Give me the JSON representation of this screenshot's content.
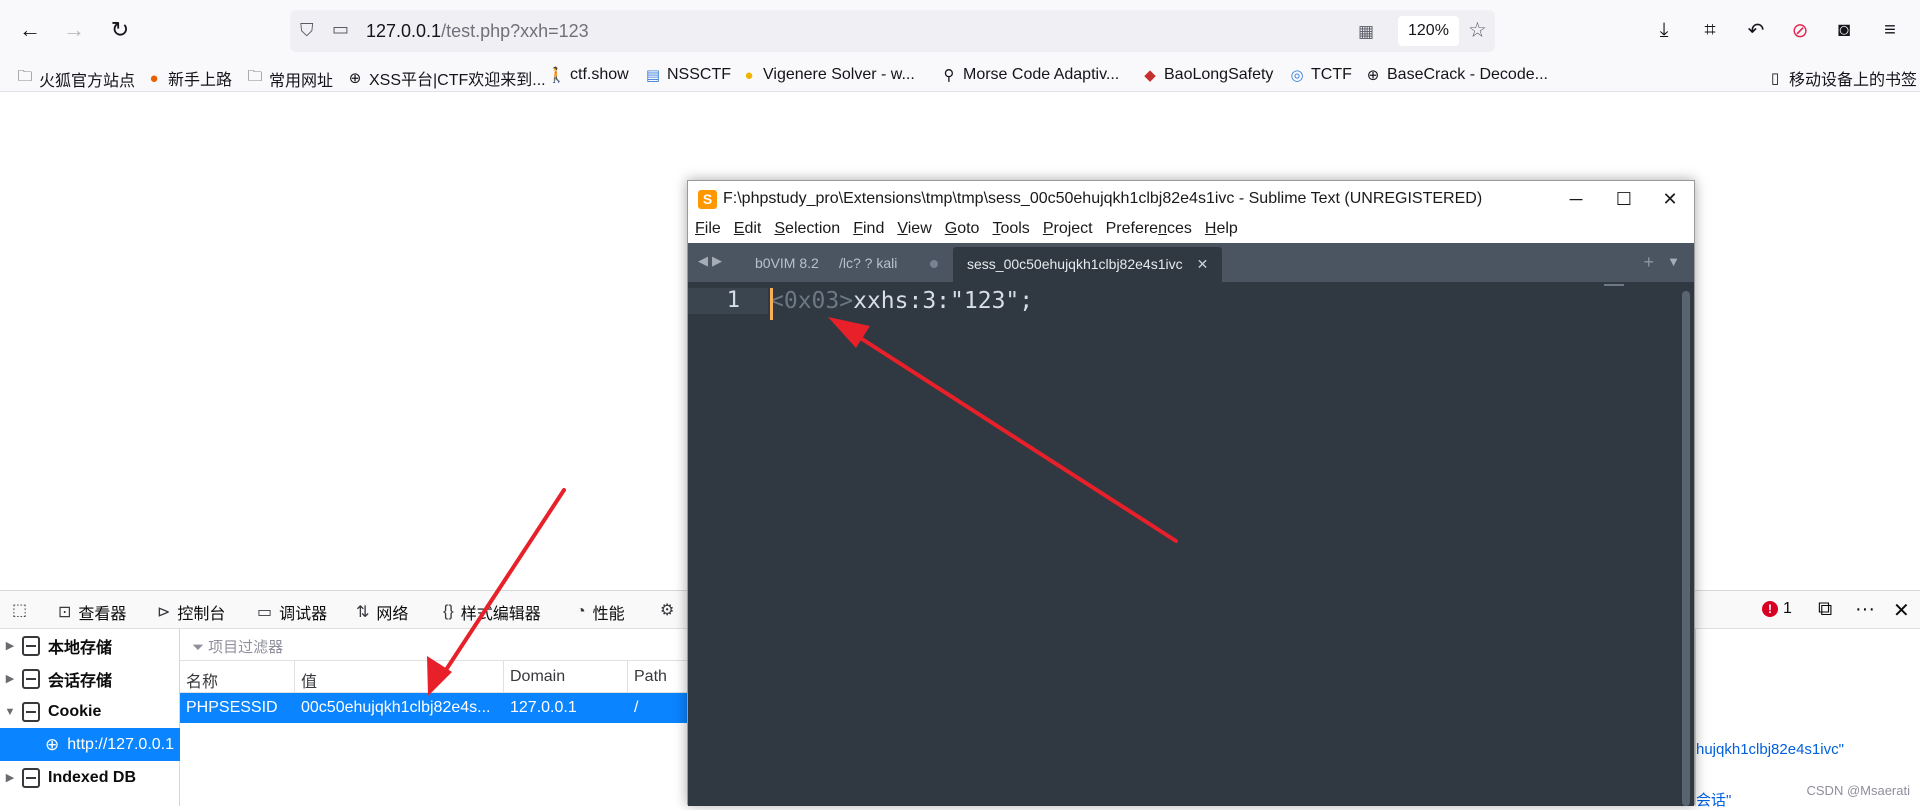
{
  "browser": {
    "url_host": "127.0.0.1",
    "url_rest": "/test.php?xxh=123",
    "zoom": "120%",
    "bookmarks": [
      {
        "label": "火狐官方站点",
        "icon": "folder-icon"
      },
      {
        "label": "新手上路",
        "icon": "firefox-icon"
      },
      {
        "label": "常用网址",
        "icon": "folder-icon"
      },
      {
        "label": "XSS平台|CTF欢迎来到...",
        "icon": "globe-icon"
      },
      {
        "label": "ctf.show",
        "icon": "ctfshow-icon"
      },
      {
        "label": "NSSCTF",
        "icon": "nssctf-icon"
      },
      {
        "label": "Vigenere Solver - w...",
        "icon": "vigenere-icon"
      },
      {
        "label": "Morse Code Adaptiv...",
        "icon": "morse-icon"
      },
      {
        "label": "BaoLongSafety",
        "icon": "baolong-icon"
      },
      {
        "label": "TCTF",
        "icon": "tctf-icon"
      },
      {
        "label": "BaseCrack - Decode...",
        "icon": "globe-icon"
      }
    ],
    "mobile_bookmarks": "移动设备上的书签"
  },
  "sublime": {
    "title": "F:\\phpstudy_pro\\Extensions\\tmp\\tmp\\sess_00c50ehujqkh1clbj82e4s1ivc - Sublime Text (UNREGISTERED)",
    "menu": [
      {
        "first": "F",
        "rest": "ile"
      },
      {
        "first": "E",
        "rest": "dit"
      },
      {
        "first": "S",
        "rest": "election"
      },
      {
        "first": "F",
        "rest": "ind"
      },
      {
        "first": "V",
        "rest": "iew"
      },
      {
        "first": "G",
        "rest": "oto"
      },
      {
        "first": "T",
        "rest": "ools"
      },
      {
        "first": "P",
        "rest": "roject"
      },
      {
        "first": "Prefere",
        "rest": "n",
        "tail": "ces"
      },
      {
        "first": "H",
        "rest": "elp"
      }
    ],
    "tabs": [
      "b0VIM 8.2",
      "/lc? ?  kali",
      "sess_00c50ehujqkh1clbj82e4s1ivc"
    ],
    "line_number": "1",
    "code_ctrl": "<0x03>",
    "code_text": "xxhs:3:\"123\";"
  },
  "devtools": {
    "tabs": [
      "查看器",
      "控制台",
      "调试器",
      "网络",
      "样式编辑器",
      "性能"
    ],
    "error_count": "1",
    "tree": {
      "local_storage": "本地存储",
      "session_storage": "会话存储",
      "cookie": "Cookie",
      "cookie_host": "http://127.0.0.1",
      "indexed_db": "Indexed DB"
    },
    "filter_placeholder": "项目过滤器",
    "columns": [
      "名称",
      "值",
      "Domain",
      "Path"
    ],
    "row": {
      "name": "PHPSESSID",
      "value": "00c50ehujqkh1clbj82e4s...",
      "domain": "127.0.0.1",
      "path": "/"
    },
    "side_lines": [
      "hujqkh1clbj82e4s1ivc\"",
      "会话\""
    ]
  },
  "watermark": "CSDN @Msaerati",
  "colors": {
    "accent": "#0a84ff",
    "editor_bg": "#303841",
    "arrow": "#e8202a"
  }
}
